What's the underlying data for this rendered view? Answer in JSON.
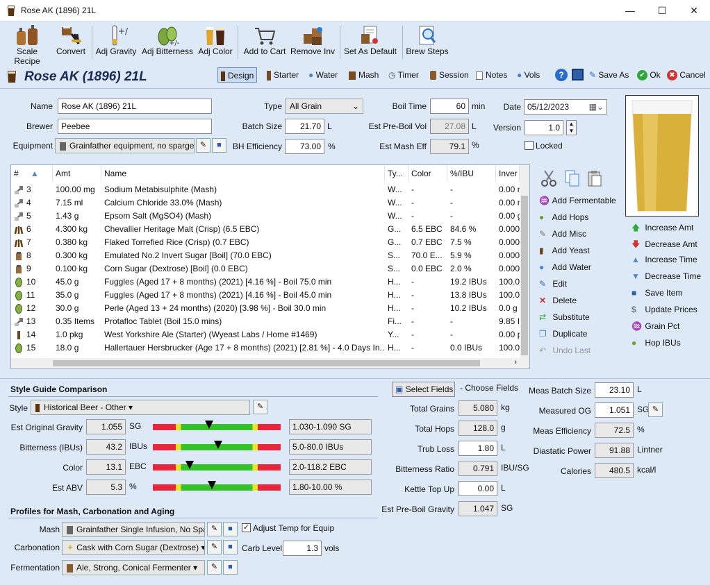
{
  "window": {
    "title": "Rose AK (1896) 21L",
    "minimize": "—",
    "maximize": "☐",
    "close": "✕"
  },
  "toolbar": [
    {
      "name": "scale-recipe",
      "label": "Scale Recipe",
      "icon": "kegs-icon"
    },
    {
      "name": "convert",
      "label": "Convert",
      "icon": "convert-icon"
    },
    {
      "name": "adj-gravity",
      "label": "Adj Gravity",
      "icon": "hydrometer-icon"
    },
    {
      "name": "adj-bitterness",
      "label": "Adj Bitterness",
      "icon": "hops-icon"
    },
    {
      "name": "adj-color",
      "label": "Adj Color",
      "icon": "beer-glasses-icon"
    },
    {
      "name": "add-to-cart",
      "label": "Add to Cart",
      "icon": "cart-icon"
    },
    {
      "name": "remove-inv",
      "label": "Remove Inv",
      "icon": "boxes-icon"
    },
    {
      "name": "set-as-default",
      "label": "Set As Default",
      "icon": "document-icon"
    },
    {
      "name": "brew-steps",
      "label": "Brew Steps",
      "icon": "magnifier-icon"
    }
  ],
  "recipe_name_header": "Rose AK (1896) 21L",
  "nav": [
    {
      "name": "design",
      "label": "Design",
      "icon": "glass-icon"
    },
    {
      "name": "starter",
      "label": "Starter",
      "icon": "flask-icon"
    },
    {
      "name": "water",
      "label": "Water",
      "icon": "droplet-icon"
    },
    {
      "name": "mash",
      "label": "Mash",
      "icon": "mash-tun-icon"
    },
    {
      "name": "timer",
      "label": "Timer",
      "icon": "clock-icon"
    },
    {
      "name": "session",
      "label": "Session",
      "icon": "keg-icon"
    },
    {
      "name": "notes",
      "label": "Notes",
      "icon": "notes-icon"
    },
    {
      "name": "vols",
      "label": "Vols",
      "icon": "droplet-icon"
    },
    {
      "name": "help",
      "label": "",
      "icon": "help-icon"
    },
    {
      "name": "save",
      "label": "",
      "icon": "save-icon"
    },
    {
      "name": "save-as",
      "label": "Save As",
      "icon": "pencil-icon"
    },
    {
      "name": "ok",
      "label": "Ok",
      "icon": "check-icon"
    },
    {
      "name": "cancel",
      "label": "Cancel",
      "icon": "cancel-icon"
    }
  ],
  "form": {
    "name_label": "Name",
    "name": "Rose AK (1896) 21L",
    "brewer_label": "Brewer",
    "brewer": "Peebee",
    "equipment_label": "Equipment",
    "equipment": "Grainfather equipment, no sparge",
    "type_label": "Type",
    "type": "All Grain",
    "batch_label": "Batch Size",
    "batch": "21.70",
    "batch_unit": "L",
    "bh_label": "BH Efficiency",
    "bh": "73.00",
    "bh_unit": "%",
    "boil_label": "Boil Time",
    "boil": "60",
    "boil_unit": "min",
    "preboil_label": "Est Pre-Boil Vol",
    "preboil": "27.08",
    "preboil_unit": "L",
    "masheff_label": "Est Mash Eff",
    "masheff": "79.1",
    "masheff_unit": "%",
    "date_label": "Date",
    "date": "05/12/2023",
    "version_label": "Version",
    "version": "1.0",
    "locked_label": "Locked"
  },
  "grid": {
    "headers": [
      "#",
      "Amt",
      "Name",
      "Ty...",
      "Color",
      "%/IBU",
      "Inver"
    ],
    "rows": [
      {
        "n": "3",
        "amt": "100.00 mg",
        "name": "Sodium Metabisulphite (Mash)",
        "ty": "W...",
        "color": "-",
        "pct": "-",
        "inv": "0.00 n",
        "icon": "misc"
      },
      {
        "n": "4",
        "amt": "7.15 ml",
        "name": "Calcium Chloride 33.0% (Mash)",
        "ty": "W...",
        "color": "-",
        "pct": "-",
        "inv": "0.00 n",
        "icon": "misc"
      },
      {
        "n": "5",
        "amt": "1.43 g",
        "name": "Epsom Salt (MgSO4) (Mash)",
        "ty": "W...",
        "color": "-",
        "pct": "-",
        "inv": "0.00 g",
        "icon": "misc"
      },
      {
        "n": "6",
        "amt": "4.300 kg",
        "name": "Chevallier Heritage Malt (Crisp) (6.5 EBC)",
        "ty": "G...",
        "color": "6.5 EBC",
        "pct": "84.6 %",
        "inv": "0.000",
        "icon": "grain"
      },
      {
        "n": "7",
        "amt": "0.380 kg",
        "name": "Flaked Torrefied Rice (Crisp) (0.7 EBC)",
        "ty": "G...",
        "color": "0.7 EBC",
        "pct": "7.5 %",
        "inv": "0.000",
        "icon": "grain"
      },
      {
        "n": "8",
        "amt": "0.300 kg",
        "name": "Emulated No.2 Invert Sugar [Boil] (70.0 EBC)",
        "ty": "S...",
        "color": "70.0 E...",
        "pct": "5.9 %",
        "inv": "0.000",
        "icon": "sugar"
      },
      {
        "n": "9",
        "amt": "0.100 kg",
        "name": "Corn Sugar (Dextrose) [Boil] (0.0 EBC)",
        "ty": "S...",
        "color": "0.0 EBC",
        "pct": "2.0 %",
        "inv": "0.000",
        "icon": "sugar"
      },
      {
        "n": "10",
        "amt": "45.0 g",
        "name": "Fuggles (Aged 17 + 8 months) (2021) [4.16 %] - Boil 75.0 min",
        "ty": "H...",
        "color": "-",
        "pct": "19.2 IBUs",
        "inv": "100.0",
        "icon": "hop"
      },
      {
        "n": "11",
        "amt": "35.0 g",
        "name": "Fuggles (Aged 17 + 8 months) (2021) [4.16 %] - Boil 45.0 min",
        "ty": "H...",
        "color": "-",
        "pct": "13.8 IBUs",
        "inv": "100.0",
        "icon": "hop"
      },
      {
        "n": "12",
        "amt": "30.0 g",
        "name": "Perle (Aged 13 + 24 months) (2020) [3.98 %] - Boil 30.0 min",
        "ty": "H...",
        "color": "-",
        "pct": "10.2 IBUs",
        "inv": "0.0 g",
        "icon": "hop"
      },
      {
        "n": "13",
        "amt": "0.35 Items",
        "name": "Protafloc Tablet (Boil 15.0 mins)",
        "ty": "Fi...",
        "color": "-",
        "pct": "-",
        "inv": "9.85 I",
        "icon": "misc"
      },
      {
        "n": "14",
        "amt": "1.0 pkg",
        "name": "West Yorkshire Ale (Starter) (Wyeast Labs / Home #1469)",
        "ty": "Y...",
        "color": "-",
        "pct": "-",
        "inv": "0.00 p",
        "icon": "yeast"
      },
      {
        "n": "15",
        "amt": "18.0 g",
        "name": "Hallertauer Hersbrucker (Age 17 + 8 months) (2021) [2.81 %] - 4.0 Days In...",
        "ty": "H...",
        "color": "-",
        "pct": "0.0 IBUs",
        "inv": "100.0",
        "icon": "hop"
      }
    ]
  },
  "actions": [
    "Add Fermentable",
    "Add Hops",
    "Add Misc",
    "Add Yeast",
    "Add Water",
    "Edit",
    "Delete",
    "Substitute",
    "Duplicate",
    "Undo Last"
  ],
  "actions2": [
    "Increase Amt",
    "Decrease Amt",
    "Increase Time",
    "Decrease Time",
    "Save Item",
    "Update Prices",
    "Grain Pct",
    "Hop IBUs"
  ],
  "style": {
    "section": "Style Guide Comparison",
    "style_label": "Style",
    "style_value": "Historical Beer - Other",
    "rows": [
      {
        "label": "Est Original Gravity",
        "value": "1.055",
        "unit": "SG",
        "range": "1.030-1.090 SG",
        "pos": 0.44
      },
      {
        "label": "Bitterness (IBUs)",
        "value": "43.2",
        "unit": "IBUs",
        "range": "5.0-80.0 IBUs",
        "pos": 0.51
      },
      {
        "label": "Color",
        "value": "13.1",
        "unit": "EBC",
        "range": "2.0-118.2 EBC",
        "pos": 0.29
      },
      {
        "label": "Est ABV",
        "value": "5.3",
        "unit": "%",
        "range": "1.80-10.00 %",
        "pos": 0.46
      }
    ]
  },
  "profiles": {
    "section": "Profiles for Mash, Carbonation and Aging",
    "mash_label": "Mash",
    "mash": "Grainfather Single Infusion, No Spa",
    "adjust_label": "Adjust Temp for Equip",
    "carb_label": "Carbonation",
    "carb": "Cask with Corn Sugar (Dextrose)",
    "carblevel_label": "Carb Level",
    "carblevel": "1.3",
    "carblevel_unit": "vols",
    "ferm_label": "Fermentation",
    "ferm": "Ale, Strong, Conical Fermenter"
  },
  "mid": {
    "select_fields": "Select Fields",
    "choose": "- Choose Fields",
    "rows": [
      {
        "label": "Total Grains",
        "value": "5.080",
        "unit": "kg",
        "ro": true
      },
      {
        "label": "Total Hops",
        "value": "128.0",
        "unit": "g",
        "ro": true
      },
      {
        "label": "Trub Loss",
        "value": "1.80",
        "unit": "L",
        "ro": false
      },
      {
        "label": "Bitterness Ratio",
        "value": "0.791",
        "unit": "IBU/SG",
        "ro": true
      },
      {
        "label": "Kettle Top Up",
        "value": "0.00",
        "unit": "L",
        "ro": false
      },
      {
        "label": "Est Pre-Boil Gravity",
        "value": "1.047",
        "unit": "SG",
        "ro": true
      }
    ]
  },
  "right": {
    "rows": [
      {
        "label": "Meas Batch Size",
        "value": "23.10",
        "unit": "L",
        "ro": false
      },
      {
        "label": "Measured OG",
        "value": "1.051",
        "unit": "SG",
        "ro": false
      },
      {
        "label": "Meas Efficiency",
        "value": "72.5",
        "unit": "%",
        "ro": true
      },
      {
        "label": "Diastatic Power",
        "value": "91.88",
        "unit": "Lintner",
        "ro": true
      },
      {
        "label": "Calories",
        "value": "480.5",
        "unit": "kcal/l",
        "ro": true
      }
    ]
  },
  "colors": {
    "beer": "#d9b13a",
    "beer_light": "#e7c75c"
  }
}
